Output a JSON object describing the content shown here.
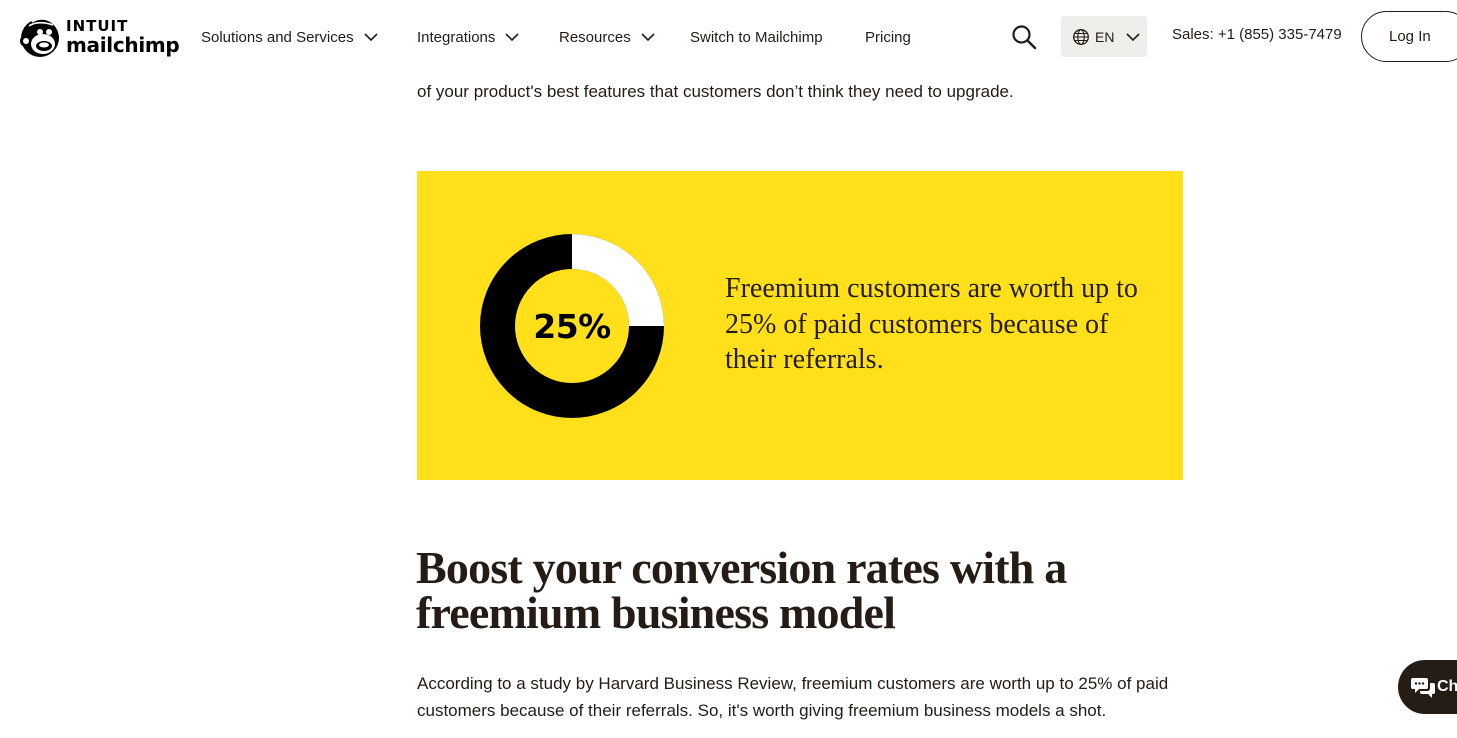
{
  "header": {
    "logo": {
      "brand_top": "INTUIT",
      "brand_bottom": "mailchimp"
    },
    "nav": [
      {
        "label": "Solutions and Services",
        "has_dropdown": true
      },
      {
        "label": "Integrations",
        "has_dropdown": true
      },
      {
        "label": "Resources",
        "has_dropdown": true
      },
      {
        "label": "Switch to Mailchimp",
        "has_dropdown": false
      },
      {
        "label": "Pricing",
        "has_dropdown": false
      }
    ],
    "search_icon": "search-icon",
    "language": {
      "label": "EN",
      "icon": "globe-icon"
    },
    "sales": "Sales: +1 (855) 335-7479",
    "login_label": "Log In"
  },
  "content": {
    "intro_text": "of your product's best features that customers don’t think they need to upgrade.",
    "stat": {
      "percent_label": "25%",
      "fraction": 0.25,
      "text": "Freemium customers are worth up to 25% of paid customers because of their referrals."
    },
    "heading": "Boost your conversion rates with a freemium business model",
    "body": "According to a study by Harvard Business Review, freemium customers are worth up to 25% of paid customers because of their referrals. So, it's worth giving freemium business models a shot."
  },
  "chat": {
    "label": "Ch"
  },
  "colors": {
    "brand_yellow": "#ffe01b",
    "text": "#241c15",
    "lang_bg": "#efeeea"
  }
}
